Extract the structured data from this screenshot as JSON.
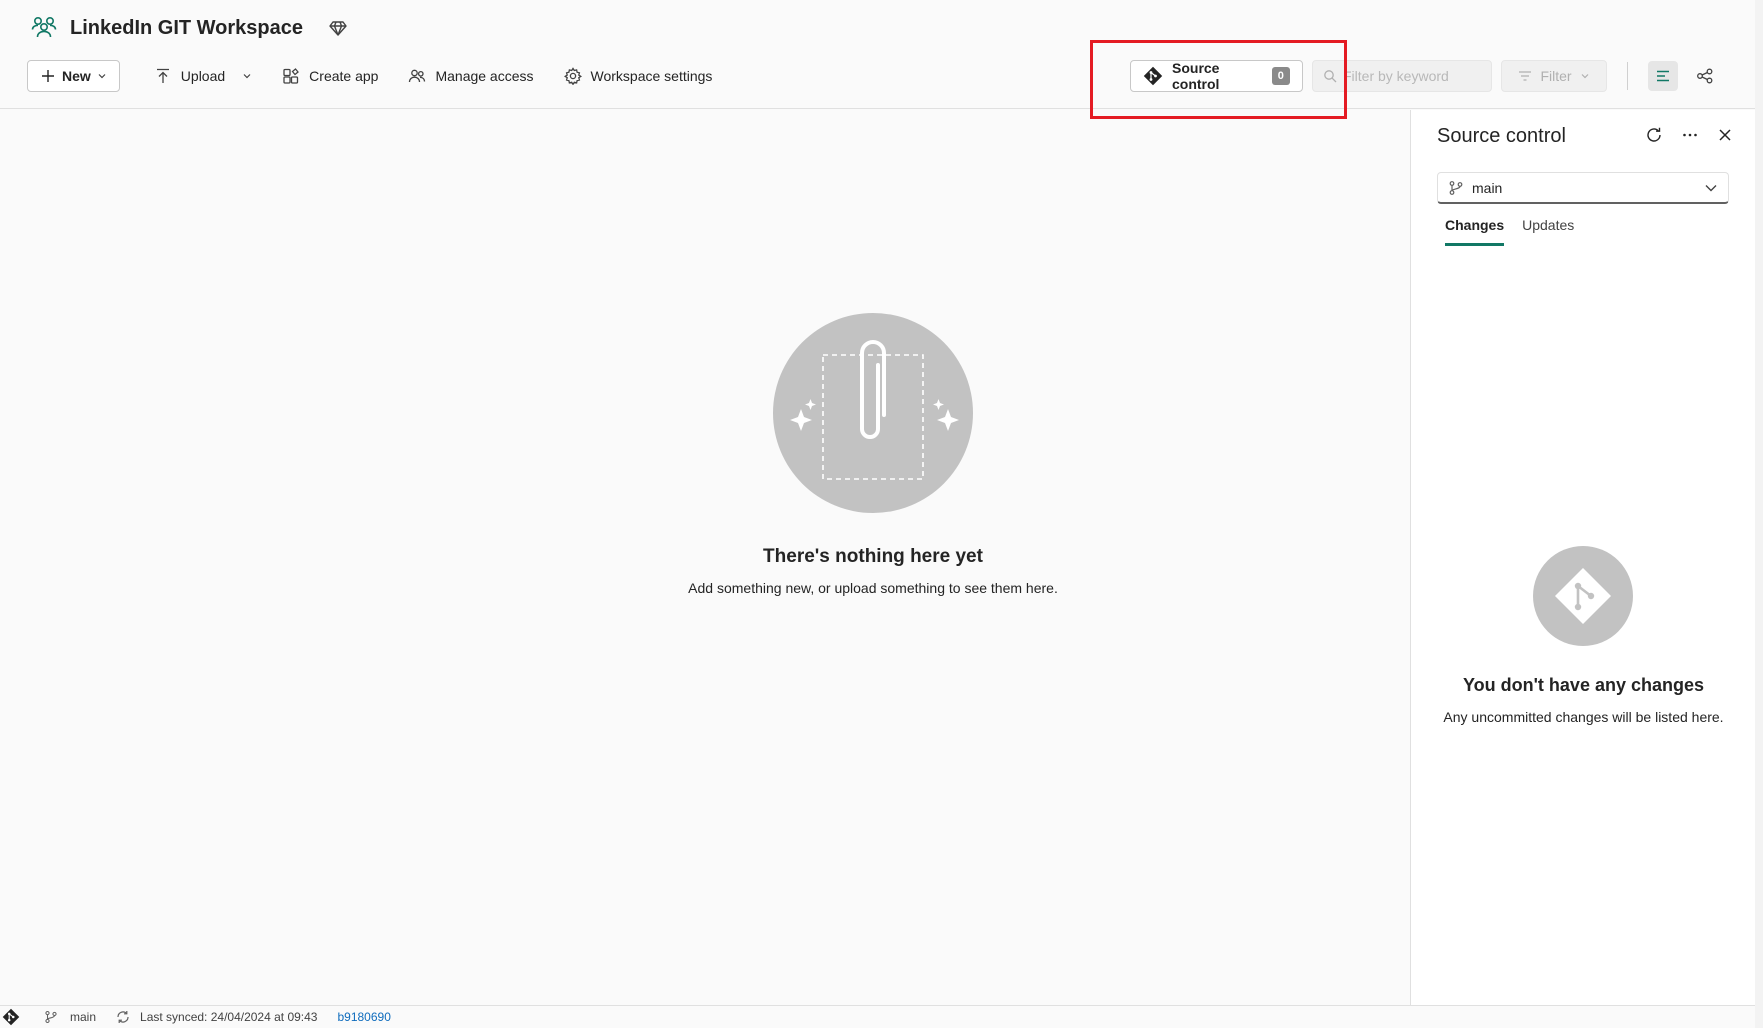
{
  "workspace": {
    "title": "LinkedIn GIT Workspace"
  },
  "toolbar": {
    "new_label": "New",
    "upload_label": "Upload",
    "create_app_label": "Create app",
    "manage_access_label": "Manage access",
    "workspace_settings_label": "Workspace settings",
    "source_control_label": "Source control",
    "source_control_count": "0",
    "search_placeholder": "Filter by keyword",
    "filter_label": "Filter"
  },
  "main": {
    "empty_title": "There's nothing here yet",
    "empty_subtitle": "Add something new, or upload something to see them here."
  },
  "panel": {
    "title": "Source control",
    "branch": "main",
    "tabs": [
      {
        "label": "Changes",
        "active": true
      },
      {
        "label": "Updates",
        "active": false
      }
    ],
    "empty_title": "You don't have any changes",
    "empty_subtitle": "Any uncommitted changes will be listed here."
  },
  "statusbar": {
    "branch": "main",
    "last_synced": "Last synced: 24/04/2024 at 09:43",
    "commit": "b9180690"
  },
  "colors": {
    "accent": "#117865",
    "highlight": "#e41b23",
    "illustration": "#c2c2c2"
  },
  "icons": {
    "workspace": "workspace-people-icon",
    "premium": "diamond-icon",
    "git": "git-icon",
    "branch": "branch-icon",
    "sync": "sync-icon"
  }
}
